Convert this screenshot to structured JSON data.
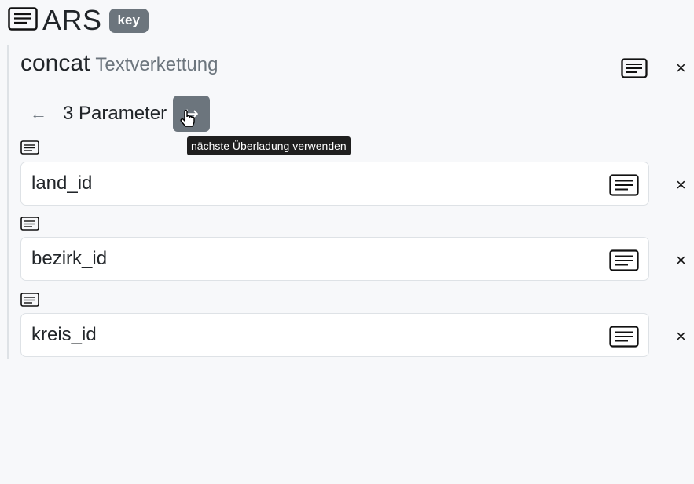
{
  "header": {
    "title": "ARS",
    "badge": "key"
  },
  "function": {
    "name": "concat",
    "description": "Textverkettung"
  },
  "overload": {
    "label": "3 Parameter",
    "prev_icon": "←",
    "next_icon": "↪"
  },
  "tooltip": "nächste Überladung verwenden",
  "close_symbol": "×",
  "params": [
    {
      "value": "land_id"
    },
    {
      "value": "bezirk_id"
    },
    {
      "value": "kreis_id"
    }
  ],
  "colors": {
    "badge": "#6c757d",
    "tooltip_bg": "#1f1f1f",
    "panel_border": "#dee2e6"
  }
}
